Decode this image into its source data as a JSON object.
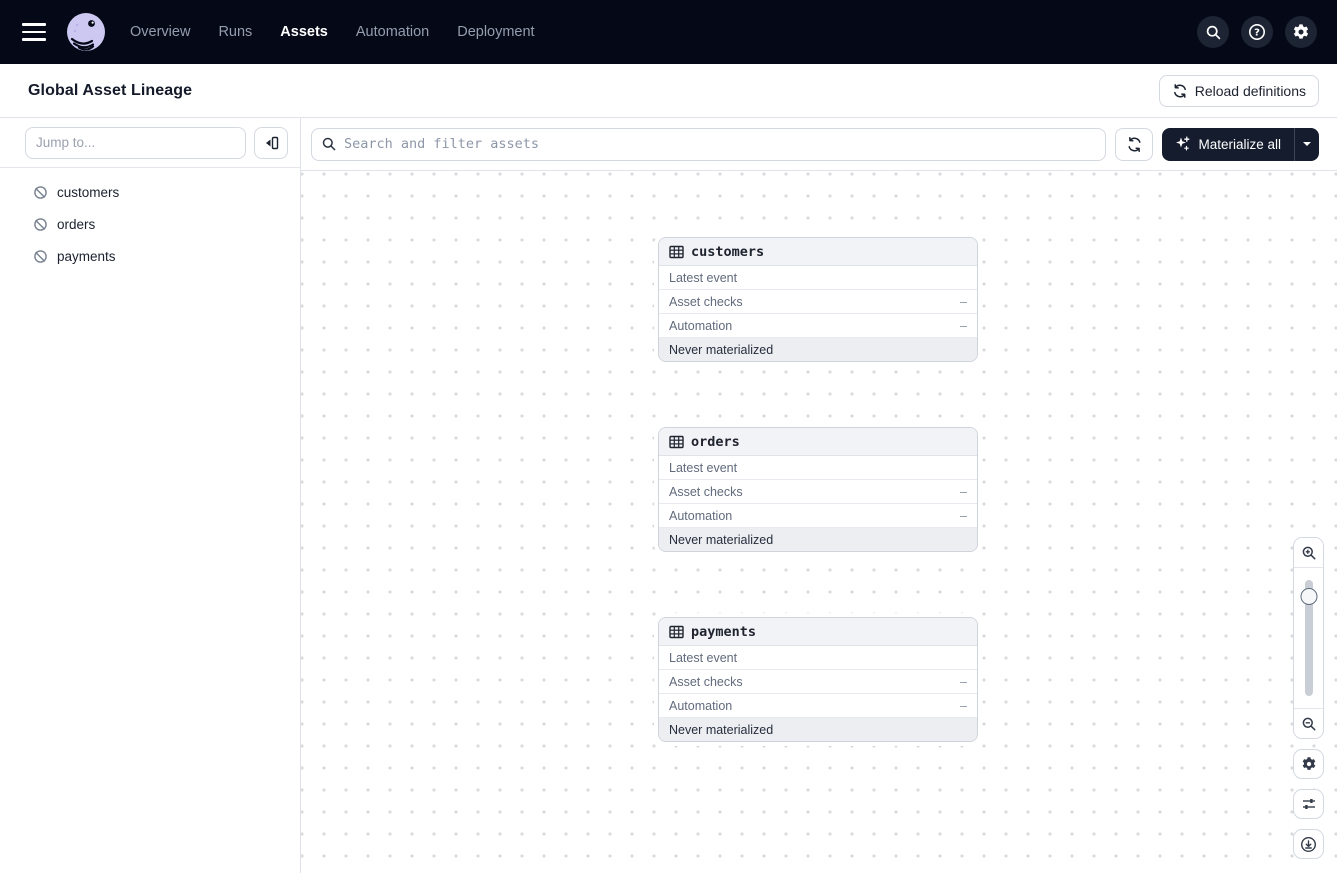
{
  "colors": {
    "nav_bg": "#040817",
    "nav_icon_bg": "#1d2433",
    "accent_dark_button": "#151c2e",
    "border": "#d4d8e0",
    "card_header_bg": "#f1f3f7",
    "card_footer_bg": "#eceef2",
    "dot_grid": "#d9dadd",
    "logo_lavender": "#cdc8f1"
  },
  "topnav": {
    "nav_items": [
      {
        "label": "Overview",
        "active": false
      },
      {
        "label": "Runs",
        "active": false
      },
      {
        "label": "Assets",
        "active": true
      },
      {
        "label": "Automation",
        "active": false
      },
      {
        "label": "Deployment",
        "active": false
      }
    ],
    "icons": [
      "menu-icon",
      "dagster-logo",
      "search-icon",
      "help-icon",
      "settings-icon"
    ]
  },
  "header": {
    "title": "Global Asset Lineage",
    "reload_button": "Reload definitions"
  },
  "sidebar": {
    "jump_placeholder": "Jump to...",
    "collapse_icon": "collapse-panel-icon",
    "assets": [
      {
        "name": "customers",
        "icon": "status-none-icon"
      },
      {
        "name": "orders",
        "icon": "status-none-icon"
      },
      {
        "name": "payments",
        "icon": "status-none-icon"
      }
    ]
  },
  "toolbar": {
    "search_placeholder": "Search and filter assets",
    "refresh_icon": "refresh-icon",
    "materialize_label": "Materialize all",
    "materialize_icon": "sparkle-icon",
    "dropdown_icon": "caret-down-icon"
  },
  "graph": {
    "nodes": [
      {
        "name": "customers",
        "icon": "table-icon",
        "rows": [
          {
            "label": "Latest event",
            "value": ""
          },
          {
            "label": "Asset checks",
            "value": "–"
          },
          {
            "label": "Automation",
            "value": "–"
          }
        ],
        "status": "Never materialized"
      },
      {
        "name": "orders",
        "icon": "table-icon",
        "rows": [
          {
            "label": "Latest event",
            "value": ""
          },
          {
            "label": "Asset checks",
            "value": "–"
          },
          {
            "label": "Automation",
            "value": "–"
          }
        ],
        "status": "Never materialized"
      },
      {
        "name": "payments",
        "icon": "table-icon",
        "rows": [
          {
            "label": "Latest event",
            "value": ""
          },
          {
            "label": "Asset checks",
            "value": "–"
          },
          {
            "label": "Automation",
            "value": "–"
          }
        ],
        "status": "Never materialized"
      }
    ],
    "zoom_controls": [
      "zoom-in-icon",
      "zoom-slider",
      "zoom-out-icon",
      "settings-icon",
      "filters-icon",
      "recenter-icon"
    ]
  }
}
